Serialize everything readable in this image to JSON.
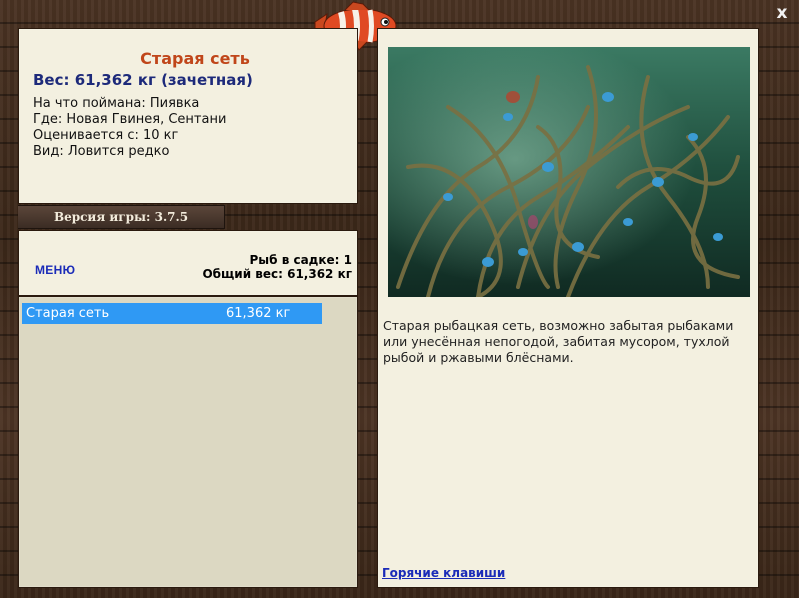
{
  "fish": {
    "name": "Старая сеть",
    "weight_line": "Вес: 61,362 кг (зачетная)",
    "caught_on": "На что поймана: Пиявка",
    "location": "Где: Новая Гвинея, Сентани",
    "rated_from": "Оценивается с: 10 кг",
    "rarity": "Вид: Ловится редко"
  },
  "version": "Версия игры: 3.7.5",
  "menu": {
    "label": "МЕНЮ"
  },
  "stats": {
    "fish_in_keepnet": "Рыб в садке: 1",
    "total_weight": "Общий вес: 61,362 кг"
  },
  "catch_list": [
    {
      "name": "Старая сеть",
      "weight": "61,362 кг"
    }
  ],
  "detail": {
    "description": "Старая рыбацкая сеть, возможно забытая рыбаками или унесённая непогодой, забитая мусором, тухлой рыбой и ржавыми блёснами.",
    "hotkeys_link": "Горячие клавиши"
  },
  "close_label": "x",
  "colors": {
    "fish_name": "#c0461a",
    "weight": "#1d2a7a",
    "selection": "#2f99f4",
    "link": "#1a2bb8",
    "panel": "#f3f0e0"
  },
  "icons": [
    "fish-logo-icon",
    "close-icon"
  ]
}
